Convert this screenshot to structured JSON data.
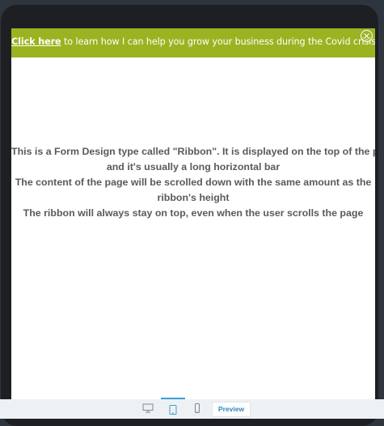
{
  "ribbon": {
    "link_label": "Click here",
    "message": " to learn how I can help you grow your business during the Covid crisis.",
    "background": "#9bb321",
    "close_icon": "close-circle-icon"
  },
  "content": {
    "lines": [
      "This is a Form Design type called \"Ribbon\". It is displayed on the top of the page",
      "and it's usually a long horizontal bar",
      "The content of the page will be scrolled down with the same amount as the",
      "ribbon's height",
      "The ribbon will always stay on top, even when the user scrolls the page"
    ]
  },
  "toolbar": {
    "devices": [
      "desktop-icon",
      "tablet-icon",
      "mobile-icon"
    ],
    "active_device": "tablet",
    "preview_label": "Preview",
    "accent": "#3aa0d6"
  }
}
